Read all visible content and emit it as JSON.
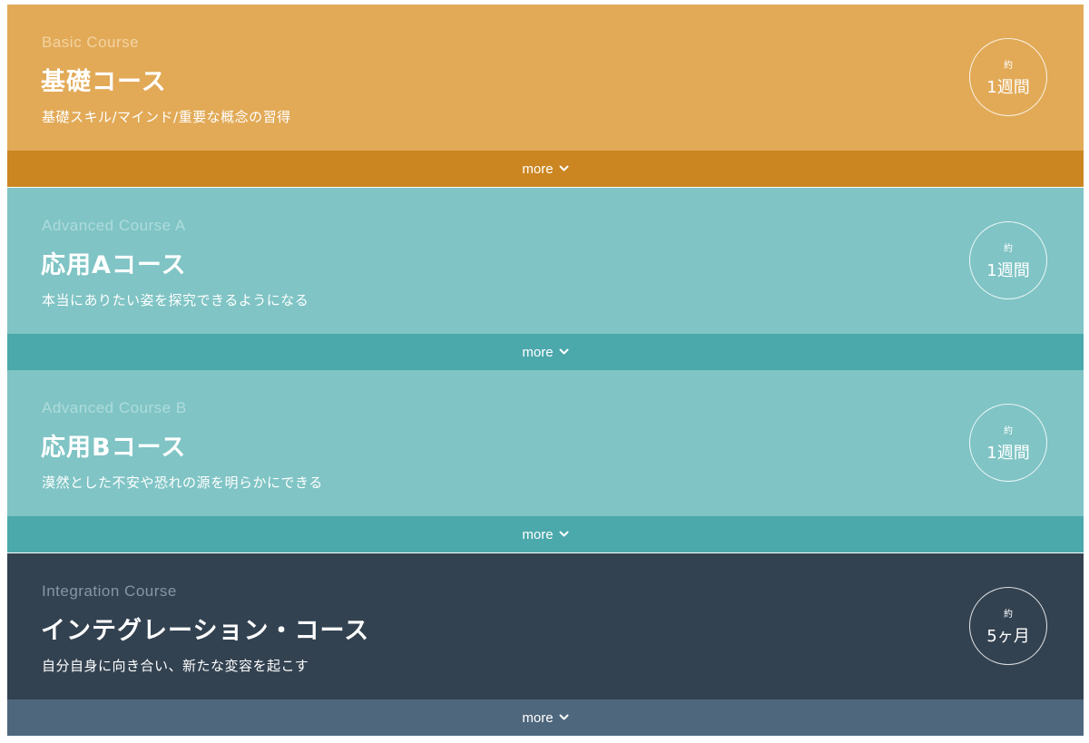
{
  "colors": {
    "basic_body": "#e2aa57",
    "basic_more": "#cb8622",
    "basic_en": "#f3d3a3",
    "advanced_body": "#80c4c5",
    "advanced_more": "#4ba8ab",
    "advanced_en": "#aedcdd",
    "integration_body": "#334251",
    "integration_more": "#4f677d",
    "integration_en": "#8896a3"
  },
  "more_icon": "chevron-down-icon",
  "courses": [
    {
      "en_label": "Basic Course",
      "title": "基礎コース",
      "description": "基礎スキル/マインド/重要な概念の習得",
      "duration_prefix": "約",
      "duration": "1週間",
      "more_label": "more"
    },
    {
      "en_label": "Advanced Course A",
      "title": "応用Aコース",
      "description": "本当にありたい姿を探究できるようになる",
      "duration_prefix": "約",
      "duration": "1週間",
      "more_label": "more"
    },
    {
      "en_label": "Advanced Course B",
      "title": "応用Bコース",
      "description": "漠然とした不安や恐れの源を明らかにできる",
      "duration_prefix": "約",
      "duration": "1週間",
      "more_label": "more"
    },
    {
      "en_label": "Integration Course",
      "title": "インテグレーション・コース",
      "description": "自分自身に向き合い、新たな変容を起こす",
      "duration_prefix": "約",
      "duration": "5ヶ月",
      "more_label": "more"
    }
  ]
}
